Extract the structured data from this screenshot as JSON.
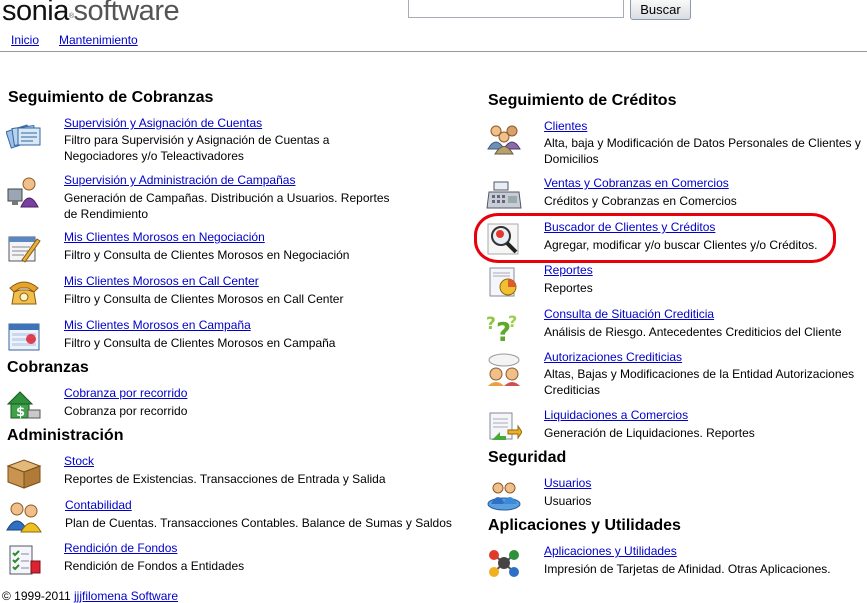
{
  "header": {
    "logo_part1": "sonia",
    "logo_reg": "®",
    "logo_part2": "software",
    "search": {
      "value": "",
      "placeholder": ""
    },
    "search_button": "Buscar"
  },
  "nav": [
    {
      "label": "Inicio"
    },
    {
      "label": "Mantenimiento"
    }
  ],
  "left": {
    "cobranzas_seg": {
      "title": "Seguimiento de Cobranzas",
      "items": [
        {
          "link": "Supervisión y Asignación de Cuentas",
          "desc": "Filtro para Supervisión y Asignación de Cuentas a Negociadores y/o Teleactivadores",
          "icon": "accounts-cards-icon"
        },
        {
          "link": "Supervisión y Administración de Campañas",
          "desc": "Generación de Campañas. Distribución a Usuarios. Reportes de Rendimiento",
          "icon": "user-computer-icon"
        },
        {
          "link": "Mis Clientes Morosos en Negociación",
          "desc": "Filtro y Consulta de Clientes Morosos en Negociación",
          "icon": "edit-document-icon"
        },
        {
          "link": "Mis Clientes Morosos en Call Center",
          "desc": "Filtro y Consulta de Clientes Morosos en Call Center",
          "icon": "telephone-icon"
        },
        {
          "link": "Mis Clientes Morosos en Campaña",
          "desc": "Filtro y Consulta de Clientes Morosos en Campaña",
          "icon": "calendar-window-icon"
        }
      ]
    },
    "cobranzas": {
      "title": "Cobranzas",
      "items": [
        {
          "link": "Cobranza por recorrido",
          "desc": "Cobranza por recorrido",
          "icon": "money-house-icon"
        }
      ]
    },
    "administracion": {
      "title": "Administración",
      "items": [
        {
          "link": "Stock",
          "desc": "Reportes de Existencias. Transacciones de Entrada y Salida",
          "icon": "box-icon"
        },
        {
          "link": "Contabilidad",
          "desc": "Plan de Cuentas. Transacciones Contables. Balance de Sumas y Saldos",
          "icon": "users-icon"
        },
        {
          "link": "Rendición de Fondos",
          "desc": "Rendición de Fondos a Entidades",
          "icon": "checklist-icon"
        }
      ]
    }
  },
  "right": {
    "creditos_seg": {
      "title": "Seguimiento de Créditos",
      "items": [
        {
          "link": "Clientes",
          "desc": "Alta, baja y Modificación de Datos Personales de Clientes y Domicilios",
          "icon": "people-group-icon"
        },
        {
          "link": "Ventas y Cobranzas en Comercios",
          "desc": "Créditos y Cobranzas en Comercios",
          "icon": "cash-register-icon"
        },
        {
          "link": "Buscador de Clientes y Créditos",
          "desc": "Agregar, modificar y/o buscar Clientes y/o Créditos.",
          "icon": "magnifier-icon"
        },
        {
          "link": "Reportes",
          "desc": "Reportes",
          "icon": "report-chart-icon"
        },
        {
          "link": "Consulta de Situación Crediticia",
          "desc": "Análisis de Riesgo. Antecedentes Crediticios del Cliente",
          "icon": "question-marks-icon"
        },
        {
          "link": "Autorizaciones Crediticias",
          "desc": "Altas, Bajas y Modificaciones de la Entidad Autorizaciones Crediticias",
          "icon": "chat-people-icon"
        },
        {
          "link": "Liquidaciones a Comercios",
          "desc": "Generación de Liquidaciones. Reportes",
          "icon": "document-arrows-icon"
        }
      ]
    },
    "seguridad": {
      "title": "Seguridad",
      "items": [
        {
          "link": "Usuarios",
          "desc": "Usuarios",
          "icon": "users-globe-icon"
        }
      ]
    },
    "aplicaciones": {
      "title": "Aplicaciones y Utilidades",
      "items": [
        {
          "link": "Aplicaciones y Utilidades",
          "desc": "Impresión de Tarjetas de Afinidad. Otras Aplicaciones.",
          "icon": "molecule-icon"
        }
      ]
    }
  },
  "footer": {
    "copyright": "© 1999-2011",
    "link": "jjjfilomena Software"
  },
  "colors": {
    "link": "#0000cc",
    "highlight": "#e8000b",
    "divider": "#999999"
  }
}
